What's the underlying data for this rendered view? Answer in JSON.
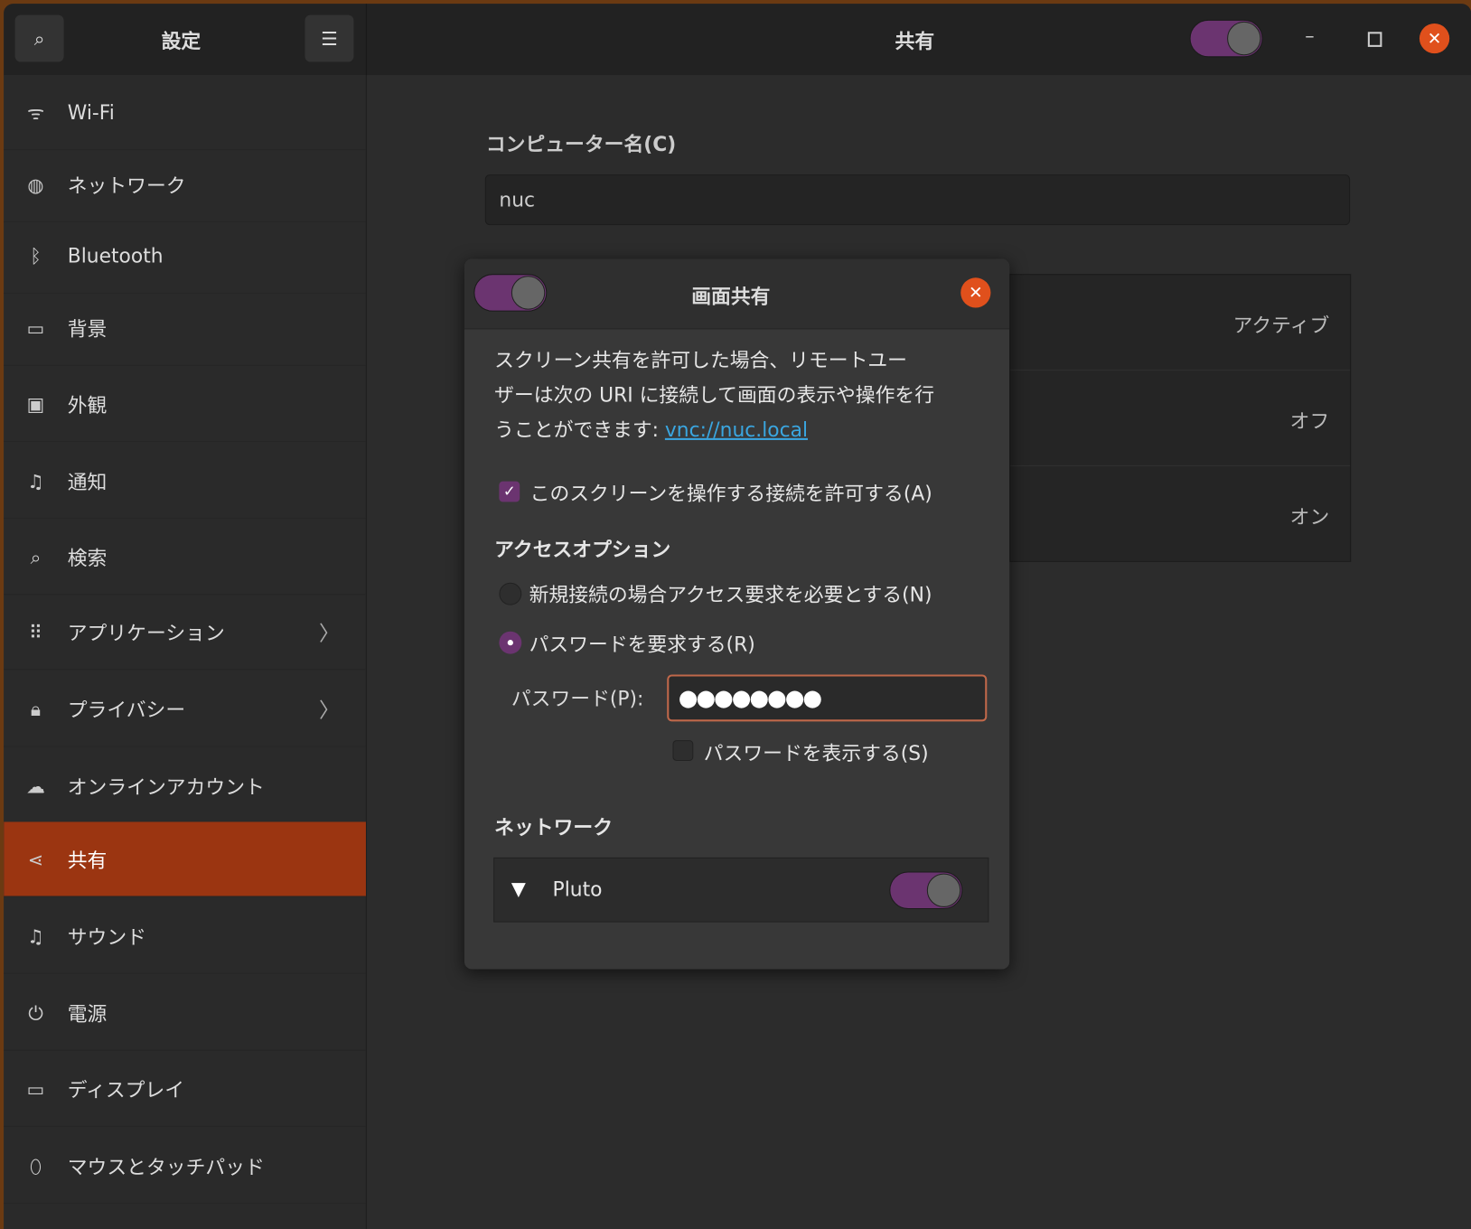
{
  "header": {
    "app_title": "設定",
    "page_title": "共有",
    "global_toggle_on": true
  },
  "sidebar": {
    "items": [
      {
        "label": "Wi-Fi",
        "icon": "wifi-icon",
        "glyph": "ᯤ"
      },
      {
        "label": "ネットワーク",
        "icon": "globe-icon",
        "glyph": "◍"
      },
      {
        "label": "Bluetooth",
        "icon": "bluetooth-icon",
        "glyph": "ᛒ"
      },
      {
        "label": "背景",
        "icon": "monitor-icon",
        "glyph": "▭"
      },
      {
        "label": "外観",
        "icon": "appearance-icon",
        "glyph": "▣"
      },
      {
        "label": "通知",
        "icon": "bell-icon",
        "glyph": "♫"
      },
      {
        "label": "検索",
        "icon": "search-icon",
        "glyph": "⌕"
      },
      {
        "label": "アプリケーション",
        "icon": "apps-grid-icon",
        "glyph": "⠿",
        "chevron": true
      },
      {
        "label": "プライバシー",
        "icon": "lock-icon",
        "glyph": "🔒︎",
        "chevron": true
      },
      {
        "label": "オンラインアカウント",
        "icon": "cloud-icon",
        "glyph": "☁"
      },
      {
        "label": "共有",
        "icon": "share-icon",
        "glyph": "⋖",
        "selected": true
      },
      {
        "label": "サウンド",
        "icon": "music-note-icon",
        "glyph": "♫"
      },
      {
        "label": "電源",
        "icon": "power-icon",
        "glyph": "⏻"
      },
      {
        "label": "ディスプレイ",
        "icon": "display-icon",
        "glyph": "▭"
      },
      {
        "label": "マウスとタッチパッド",
        "icon": "mouse-icon",
        "glyph": "⬯"
      }
    ]
  },
  "main": {
    "computer_name_label": "コンピューター名(C)",
    "computer_name_value": "nuc",
    "services_status": [
      "アクティブ",
      "オフ",
      "オン"
    ]
  },
  "dialog": {
    "title": "画面共有",
    "enabled": true,
    "description": [
      "スクリーン共有を許可した場合、リモートユー",
      "ザーは次の URI に接続して画面の表示や操作を行",
      "うことができます: "
    ],
    "uri": "vnc://nuc.local",
    "allow_control_label": "このスクリーンを操作する接続を許可する(A)",
    "allow_control_checked": true,
    "access_options_heading": "アクセスオプション",
    "option_new_connection": "新規接続の場合アクセス要求を必要とする(N)",
    "option_require_password": "パスワードを要求する(R)",
    "selected_option": "require_password",
    "password_label": "パスワード(P):",
    "password_masked": "●●●●●●●●",
    "show_password_label": "パスワードを表示する(S)",
    "show_password_checked": false,
    "network_heading": "ネットワーク",
    "network_name": "Pluto",
    "network_enabled": true
  },
  "colors": {
    "accent": "#9b3511",
    "toggle_on": "#6b3470",
    "close": "#e0501c",
    "link": "#3aa6e0"
  }
}
